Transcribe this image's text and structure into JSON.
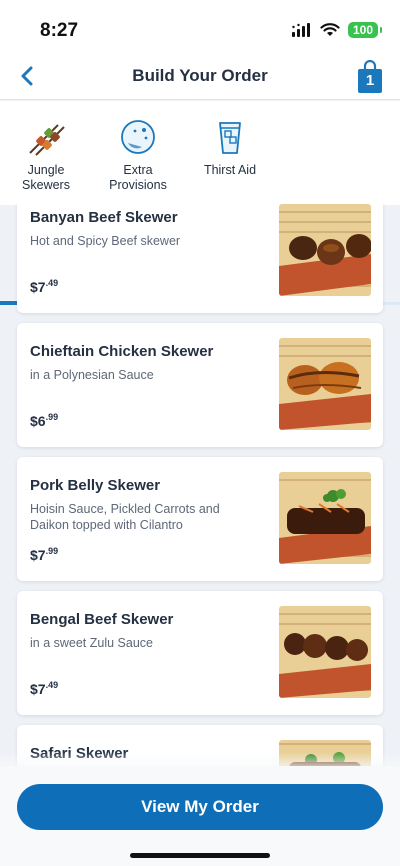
{
  "status_bar": {
    "time": "8:27",
    "battery": "100"
  },
  "nav": {
    "title": "Build Your Order",
    "bag_count": "1",
    "back_icon": "chevron-left-icon",
    "bag_icon": "shopping-bag-icon"
  },
  "categories": [
    {
      "label": "Jungle Skewers",
      "icon": "skewers-icon",
      "selected": true
    },
    {
      "label": "Extra Provisions",
      "icon": "extra-provisions-icon",
      "selected": false
    },
    {
      "label": "Thirst Aid",
      "icon": "drink-cup-icon",
      "selected": false
    }
  ],
  "items": [
    {
      "name": "Banyan Beef Skewer",
      "description": "Hot and Spicy Beef skewer",
      "price_dollars": "$7",
      "price_cents": ".49"
    },
    {
      "name": "Chieftain Chicken Skewer",
      "description": "in a Polynesian Sauce",
      "price_dollars": "$6",
      "price_cents": ".99"
    },
    {
      "name": "Pork Belly Skewer",
      "description": "Hoisin Sauce, Pickled Carrots and Daikon topped with Cilantro",
      "price_dollars": "$7",
      "price_cents": ".99"
    },
    {
      "name": "Bengal Beef Skewer",
      "description": "in a sweet Zulu Sauce",
      "price_dollars": "$7",
      "price_cents": ".49"
    },
    {
      "name": "Safari Skewer",
      "description": "",
      "price_dollars": "",
      "price_cents": ""
    }
  ],
  "footer": {
    "view_order_label": "View My Order"
  },
  "colors": {
    "accent": "#0e6fb8",
    "battery": "#39c24f",
    "text": "#253143"
  }
}
